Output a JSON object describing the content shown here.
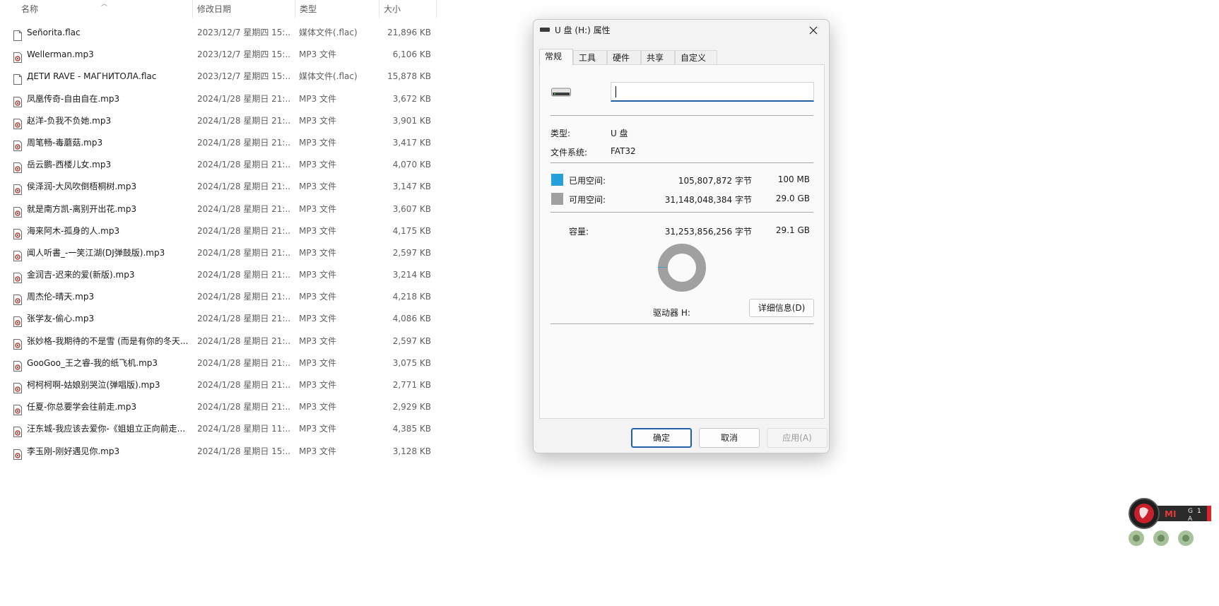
{
  "columns": {
    "name": "名称",
    "date": "修改日期",
    "type": "类型",
    "size": "大小"
  },
  "files": [
    {
      "name": "Señorita.flac",
      "date": "2023/12/7 星期四 15:...",
      "type": "媒体文件(.flac)",
      "size": "21,896 KB",
      "icon": "flac"
    },
    {
      "name": "Wellerman.mp3",
      "date": "2023/12/7 星期四 15:...",
      "type": "MP3 文件",
      "size": "6,106 KB",
      "icon": "mp3"
    },
    {
      "name": "ДЕТИ RAVE - МАГНИТОЛА.flac",
      "date": "2023/12/7 星期四 15:...",
      "type": "媒体文件(.flac)",
      "size": "15,878 KB",
      "icon": "flac"
    },
    {
      "name": "凤凰传奇-自由自在.mp3",
      "date": "2024/1/28 星期日 21:...",
      "type": "MP3 文件",
      "size": "3,672 KB",
      "icon": "mp3"
    },
    {
      "name": "赵洋-负我不负她.mp3",
      "date": "2024/1/28 星期日 21:...",
      "type": "MP3 文件",
      "size": "3,901 KB",
      "icon": "mp3"
    },
    {
      "name": "周笔畅-毒蘑菇.mp3",
      "date": "2024/1/28 星期日 21:...",
      "type": "MP3 文件",
      "size": "3,417 KB",
      "icon": "mp3"
    },
    {
      "name": "岳云鹏-西楼儿女.mp3",
      "date": "2024/1/28 星期日 21:...",
      "type": "MP3 文件",
      "size": "4,070 KB",
      "icon": "mp3"
    },
    {
      "name": "侯泽润-大风吹倒梧桐树.mp3",
      "date": "2024/1/28 星期日 21:...",
      "type": "MP3 文件",
      "size": "3,147 KB",
      "icon": "mp3"
    },
    {
      "name": "就是南方凯-离别开出花.mp3",
      "date": "2024/1/28 星期日 21:...",
      "type": "MP3 文件",
      "size": "3,607 KB",
      "icon": "mp3"
    },
    {
      "name": "海来阿木-孤身的人.mp3",
      "date": "2024/1/28 星期日 21:...",
      "type": "MP3 文件",
      "size": "4,175 KB",
      "icon": "mp3"
    },
    {
      "name": "闻人听書_-一笑江湖(DJ弹鼓版).mp3",
      "date": "2024/1/28 星期日 21:...",
      "type": "MP3 文件",
      "size": "2,597 KB",
      "icon": "mp3"
    },
    {
      "name": "金润吉-迟来的爱(新版).mp3",
      "date": "2024/1/28 星期日 21:...",
      "type": "MP3 文件",
      "size": "3,214 KB",
      "icon": "mp3"
    },
    {
      "name": "周杰伦-晴天.mp3",
      "date": "2024/1/28 星期日 21:...",
      "type": "MP3 文件",
      "size": "4,218 KB",
      "icon": "mp3"
    },
    {
      "name": "张学友-偷心.mp3",
      "date": "2024/1/28 星期日 21:...",
      "type": "MP3 文件",
      "size": "4,086 KB",
      "icon": "mp3"
    },
    {
      "name": "张妙格-我期待的不是雪 (而是有你的冬天...",
      "date": "2024/1/28 星期日 21:...",
      "type": "MP3 文件",
      "size": "2,597 KB",
      "icon": "mp3"
    },
    {
      "name": "GooGoo_王之睿-我的纸飞机.mp3",
      "date": "2024/1/28 星期日 21:...",
      "type": "MP3 文件",
      "size": "3,075 KB",
      "icon": "mp3"
    },
    {
      "name": "柯柯柯啊-姑娘别哭泣(弹唱版).mp3",
      "date": "2024/1/28 星期日 21:...",
      "type": "MP3 文件",
      "size": "2,771 KB",
      "icon": "mp3"
    },
    {
      "name": "任夏-你总要学会往前走.mp3",
      "date": "2024/1/28 星期日 21:...",
      "type": "MP3 文件",
      "size": "2,929 KB",
      "icon": "mp3"
    },
    {
      "name": "汪东城-我应该去爱你-《姐姐立正向前走...",
      "date": "2024/1/28 星期日 11:...",
      "type": "MP3 文件",
      "size": "4,385 KB",
      "icon": "mp3"
    },
    {
      "name": "李玉刚-刚好遇见你.mp3",
      "date": "2024/1/28 星期日 15:...",
      "type": "MP3 文件",
      "size": "3,128 KB",
      "icon": "mp3"
    }
  ],
  "dialog": {
    "title": "U 盘 (H:) 属性",
    "tabs": [
      "常规",
      "工具",
      "硬件",
      "共享",
      "自定义"
    ],
    "name_value": "",
    "type_label": "类型:",
    "type_value": "U 盘",
    "fs_label": "文件系统:",
    "fs_value": "FAT32",
    "used_label": "已用空间:",
    "used_bytes": "105,807,872 字节",
    "used_human": "100 MB",
    "free_label": "可用空间:",
    "free_bytes": "31,148,048,384 字节",
    "free_human": "29.0 GB",
    "capacity_label": "容量:",
    "capacity_bytes": "31,253,856,256 字节",
    "capacity_human": "29.1 GB",
    "used_fraction": 0.0034,
    "drive_label": "驱动器 H:",
    "details_button": "详细信息(D)",
    "ok_button": "确定",
    "cancel_button": "取消",
    "apply_button": "应用(A)"
  },
  "colors": {
    "used": "#26a0da",
    "free": "#a0a0a0",
    "accent": "#1f5fa8"
  },
  "tray": {
    "logo_text": "MI",
    "keys": [
      "G",
      "1",
      "A"
    ]
  }
}
